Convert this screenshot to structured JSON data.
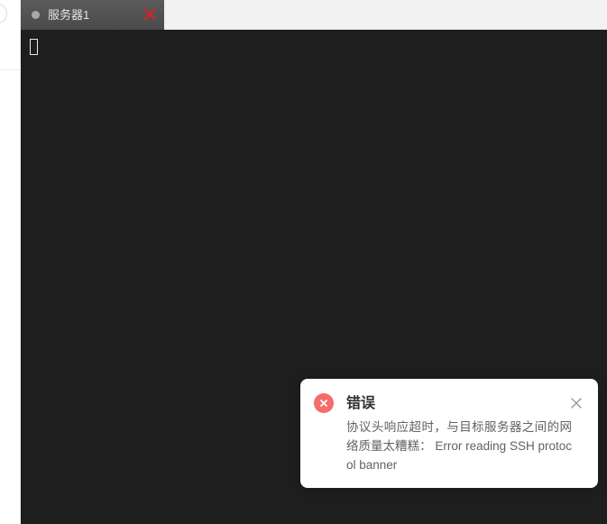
{
  "tabs": [
    {
      "label": "服务器1",
      "active": true
    }
  ],
  "terminal": {
    "background": "#1e1e1e"
  },
  "notification": {
    "type": "error",
    "title": "错误",
    "message": "协议头响应超时，与目标服务器之间的网络质量太糟糕： Error reading SSH protocol banner",
    "icon": "error-circle-icon",
    "close_icon": "close-icon",
    "error_color": "#f56c6c"
  },
  "icons": {
    "tab_status": "status-dot-icon",
    "tab_close": "tab-close-icon"
  },
  "colors": {
    "tab_close_red": "#e02020",
    "tab_bg": "#4f4f4f"
  }
}
